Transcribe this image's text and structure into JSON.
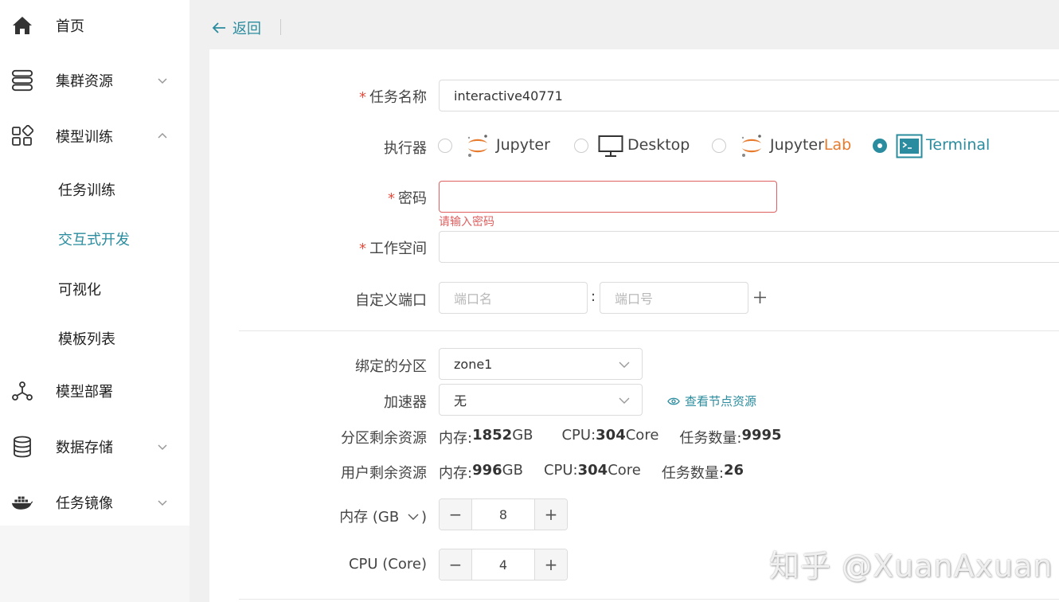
{
  "sidebar": {
    "items": [
      {
        "label": "首页",
        "icon": "home-icon"
      },
      {
        "label": "集群资源",
        "icon": "server-icon"
      },
      {
        "label": "模型训练",
        "icon": "grid-apps-icon"
      },
      {
        "label": "模型部署",
        "icon": "network-nodes-icon"
      },
      {
        "label": "数据存储",
        "icon": "database-icon"
      },
      {
        "label": "任务镜像",
        "icon": "docker-icon"
      }
    ],
    "sub_items": [
      {
        "label": "任务训练"
      },
      {
        "label": "交互式开发"
      },
      {
        "label": "可视化"
      },
      {
        "label": "模板列表"
      }
    ]
  },
  "header": {
    "back_label": "返回"
  },
  "form": {
    "task_name": {
      "label": "任务名称",
      "value": "interactive40771"
    },
    "executor": {
      "label": "执行器",
      "options": [
        {
          "label": "Jupyter"
        },
        {
          "label": "Desktop"
        },
        {
          "label_main": "Jupyter",
          "label_accent": "Lab"
        },
        {
          "label": "Terminal"
        }
      ],
      "selected": "Terminal"
    },
    "password": {
      "label": "密码",
      "value": "",
      "error": "请输入密码"
    },
    "workspace": {
      "label": "工作空间",
      "value": ""
    },
    "ports": {
      "label": "自定义端口",
      "name_placeholder": "端口名",
      "number_placeholder": "端口号",
      "separator": ":"
    },
    "zone": {
      "label": "绑定的分区",
      "value": "zone1"
    },
    "accelerator": {
      "label": "加速器",
      "value": "无",
      "view_nodes": "查看节点资源"
    },
    "zone_resources": {
      "label": "分区剩余资源",
      "mem_label": "内存: ",
      "mem_value": "1852",
      "mem_unit": " GB",
      "cpu_label": "CPU: ",
      "cpu_value": "304",
      "cpu_unit": " Core",
      "task_label": "任务数量: ",
      "task_value": "9995"
    },
    "user_resources": {
      "label": "用户剩余资源",
      "mem_label": "内存: ",
      "mem_value": "996",
      "mem_unit": " GB",
      "cpu_label": "CPU: ",
      "cpu_value": "304",
      "cpu_unit": " Core",
      "task_label": "任务数量: ",
      "task_value": "26"
    },
    "memory": {
      "label": "内存 (GB",
      "value": "8"
    },
    "cpu": {
      "label": "CPU (Core)",
      "value": "4"
    }
  },
  "watermark": "知乎 @XuanAxuan",
  "colors": {
    "accent": "#2a8c9e",
    "error": "#e06060",
    "jupyter_orange": "#e87a2d"
  }
}
